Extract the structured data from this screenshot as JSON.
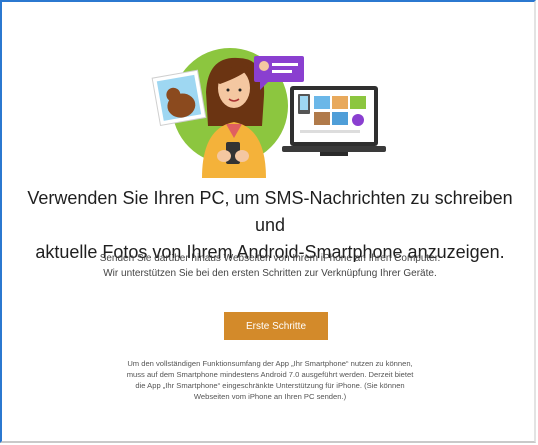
{
  "headline": {
    "line1": "Verwenden Sie Ihren PC, um SMS-Nachrichten zu schreiben und",
    "line2": "aktuelle Fotos von Ihrem Android-Smartphone anzuzeigen."
  },
  "subtext": {
    "line1": "Senden Sie darüber hinaus Webseiten von Ihrem iPhone an Ihren Computer.",
    "line2": "Wir unterstützen Sie bei den ersten Schritten zur Verknüpfung Ihrer Geräte."
  },
  "primary_button": {
    "label": "Erste Schritte"
  },
  "footnote": {
    "line1": "Um den vollständigen Funktionsumfang der App „Ihr Smartphone“ nutzen zu können,",
    "line2": "muss auf dem Smartphone mindestens Android 7.0 ausgeführt werden. Derzeit bietet",
    "line3": "die App „Ihr Smartphone“ eingeschränkte Unterstützung für iPhone. (Sie können",
    "line4": "Webseiten vom iPhone an Ihren PC senden.)"
  },
  "colors": {
    "accent_button": "#d38a2a",
    "window_border": "#2b78d0",
    "illustration_green": "#8cc63f",
    "chat_bubble": "#8a3fd0"
  }
}
